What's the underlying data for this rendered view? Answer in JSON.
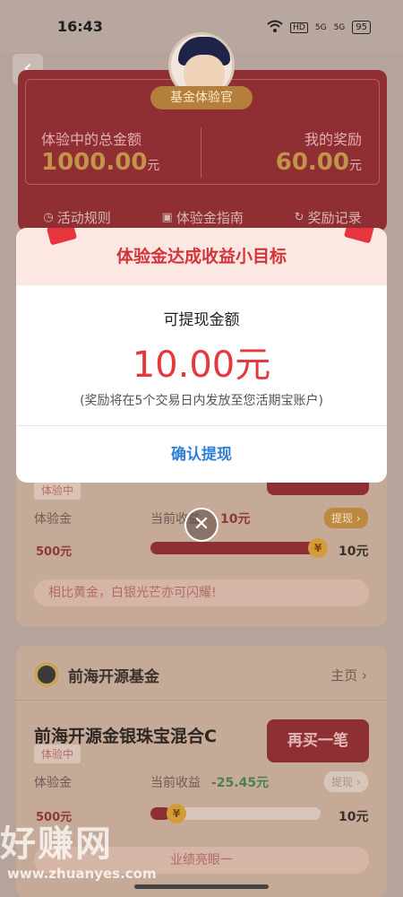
{
  "status_bar": {
    "time": "16:43",
    "network": "HD",
    "signal1": "5G",
    "signal2": "5G",
    "battery": "95"
  },
  "header": {
    "badge": "基金体验官",
    "total_label": "体验中的总金额",
    "total_amount": "1000.00",
    "total_unit": "元",
    "reward_label": "我的奖励",
    "reward_amount": "60.00",
    "reward_unit": "元",
    "links": [
      {
        "label": "活动规则",
        "icon": "clock-icon"
      },
      {
        "label": "体验金指南",
        "icon": "book-icon"
      },
      {
        "label": "奖励记录",
        "icon": "history-icon"
      }
    ]
  },
  "card1": {
    "tag": "体验中",
    "trial_label": "体验金",
    "earn_label": "当前收益",
    "earn_value": "10元",
    "withdraw_label": "提现",
    "trial_amount": "500元",
    "target_amount": "10元",
    "progress": 1.0,
    "slogan": "相比黄金，白银光芒亦可闪耀!"
  },
  "card2": {
    "company": "前海开源基金",
    "home_label": "主页",
    "fund_name": "前海开源金银珠宝混合C",
    "tag": "体验中",
    "buy_label": "再买一笔",
    "trial_label": "体验金",
    "earn_label": "当前收益",
    "earn_value": "-25.45元",
    "withdraw_label": "提现",
    "trial_amount": "500元",
    "target_amount": "10元",
    "progress": 0.12,
    "slogan_fragment": "业绩亮眼一"
  },
  "modal": {
    "title": "体验金达成收益小目标",
    "amount_label": "可提现金额",
    "amount_value": "10.00元",
    "note": "(奖励将在5个交易日内发放至您活期宝账户)",
    "confirm_label": "确认提现",
    "close_symbol": "✕"
  },
  "watermark": {
    "text": "好赚网",
    "url": "www.zhuanyes.com"
  }
}
